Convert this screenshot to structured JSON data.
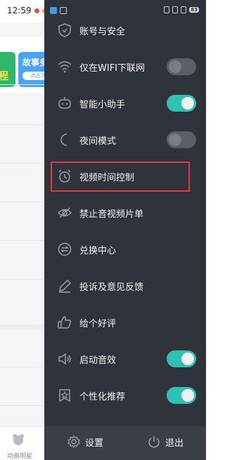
{
  "statusbar": {
    "time": "12:59",
    "battery": "83"
  },
  "background_app": {
    "card_green_text": "程",
    "card_blue_title": "故事多",
    "card_blue_pill": "点击下",
    "bottom_nav_label": "动画明星"
  },
  "menu": {
    "items": [
      {
        "label": "账号与安全",
        "icon": "shield-icon"
      },
      {
        "label": "仅在WIFI下联网",
        "icon": "wifi-icon",
        "toggle": "off"
      },
      {
        "label": "智能小助手",
        "icon": "robot-icon",
        "toggle": "on"
      },
      {
        "label": "夜间模式",
        "icon": "moon-icon",
        "toggle": "off"
      },
      {
        "label": "视频时间控制",
        "icon": "alarm-clock-icon"
      },
      {
        "label": "禁止音视频片单",
        "icon": "eye-off-icon"
      },
      {
        "label": "兑换中心",
        "icon": "exchange-icon"
      },
      {
        "label": "投诉及意见反馈",
        "icon": "pencil-icon"
      },
      {
        "label": "给个好评",
        "icon": "thumbs-up-icon"
      },
      {
        "label": "启动音效",
        "icon": "speaker-icon",
        "toggle": "on"
      },
      {
        "label": "个性化推荐",
        "icon": "star-badge-icon",
        "toggle": "on"
      }
    ],
    "highlighted": "视频时间控制"
  },
  "footer": {
    "settings_label": "设置",
    "logout_label": "退出"
  },
  "colors": {
    "drawer_bg": "#2f333b",
    "toggle_on": "#2ec2b0",
    "highlight": "#e2383f"
  }
}
